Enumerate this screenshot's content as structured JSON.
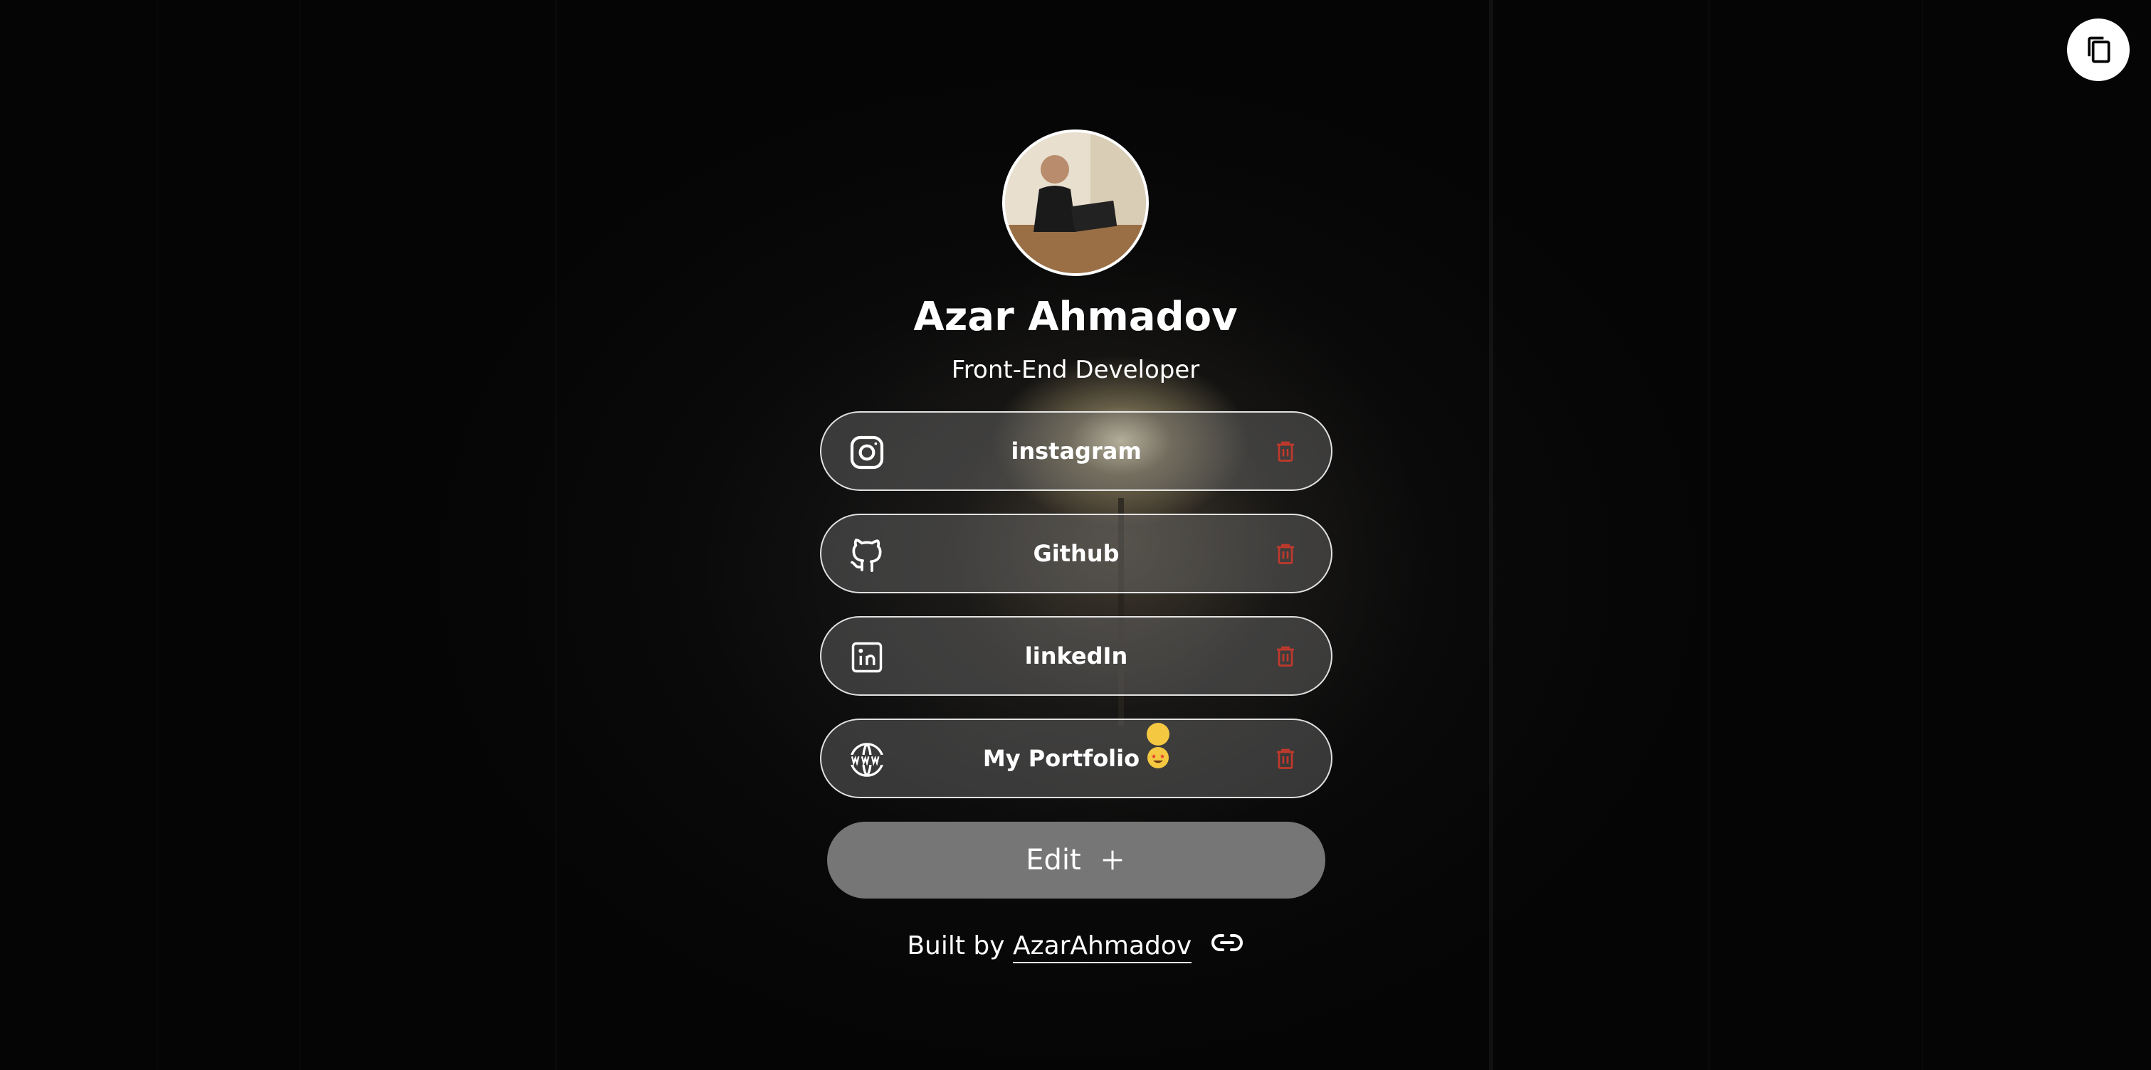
{
  "profile": {
    "name": "Azar Ahmadov",
    "title": "Front-End Developer",
    "avatar_alt": "Azar Ahmadov"
  },
  "links": [
    {
      "label": "instagram",
      "icon": "instagram-icon"
    },
    {
      "label": "Github",
      "icon": "github-icon"
    },
    {
      "label": "linkedIn",
      "icon": "linkedin-icon"
    },
    {
      "label": "My Portfolio",
      "icon": "globe-www-icon",
      "emoji": "star-struck-emoji"
    }
  ],
  "actions": {
    "edit_label": "Edit",
    "copy_icon": "copy-icon",
    "delete_icon": "trash-icon"
  },
  "footer": {
    "prefix": "Built by",
    "author_link": "AzarAhmadov",
    "link_icon": "chain-link-icon"
  },
  "colors": {
    "delete": "#c0392b",
    "edit_button": "#767676",
    "link_border": "#ffffff"
  }
}
